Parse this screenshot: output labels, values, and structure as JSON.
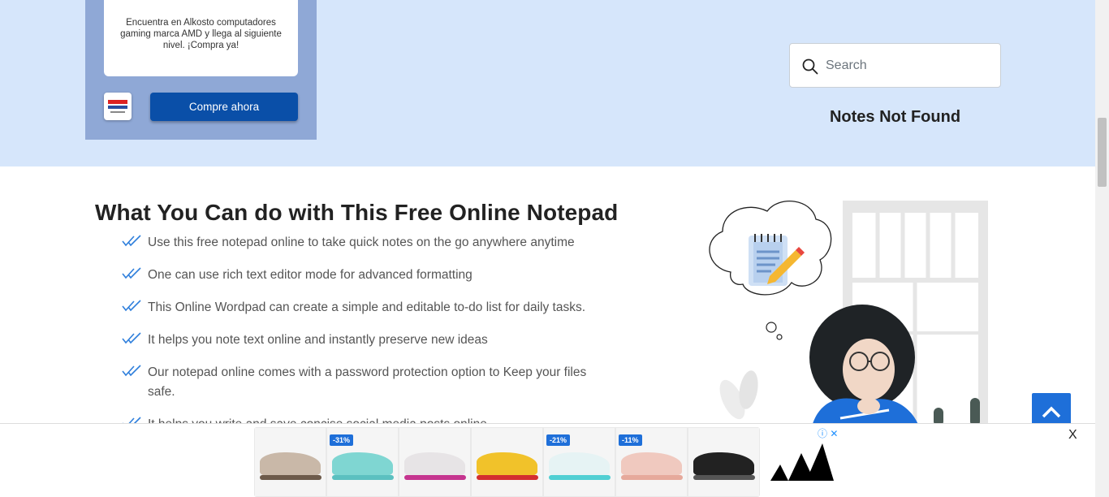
{
  "top_ad": {
    "description": "Encuentra en Alkosto computadores gaming marca AMD y llega al siguiente nivel. ¡Compra ya!",
    "cta_label": "Compre ahora",
    "logo_icon": "alkosto-logo"
  },
  "search": {
    "placeholder": "Search",
    "value": ""
  },
  "notes_status": "Notes Not Found",
  "features": {
    "title": "What You Can do with This Free Online Notepad",
    "items": [
      "Use this free notepad online to take quick notes on the go anywhere anytime",
      "One can use rich text editor mode for advanced formatting",
      "This Online Wordpad can create a simple and editable to-do list for daily tasks.",
      "It helps you note text online and instantly preserve new ideas",
      "Our notepad online comes with a password protection option to Keep your files safe.",
      "It helps you write and save concise social media posts online"
    ]
  },
  "bottom_ad": {
    "discounts": [
      "-31%",
      "-21%",
      "-11%"
    ],
    "close_label": "X",
    "adchoices_label": "ⓘ ✕",
    "brand_icon": "adidas-logo"
  },
  "colors": {
    "band": "#d6e6fb",
    "accent": "#1e6fd9",
    "cta": "#0a4fa8"
  }
}
